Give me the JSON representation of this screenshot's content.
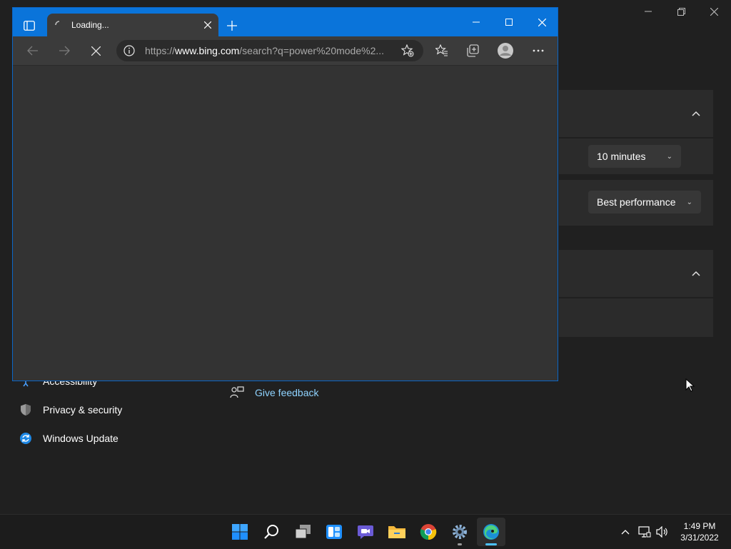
{
  "settings": {
    "sleep_value": "10 minutes",
    "power_mode_value": "Best performance",
    "nav": {
      "accessibility": "Accessibility",
      "privacy": "Privacy & security",
      "update": "Windows Update"
    },
    "feedback": "Give feedback"
  },
  "browser": {
    "tab_title": "Loading...",
    "address_prefix": "https://",
    "address_host": "www.bing.com",
    "address_path": "/search?q=power%20mode%2..."
  },
  "taskbar": {
    "time": "1:49 PM",
    "date": "3/31/2022"
  },
  "colors": {
    "accent": "#0a74da",
    "link": "#8fd3ff",
    "background": "#202020"
  }
}
